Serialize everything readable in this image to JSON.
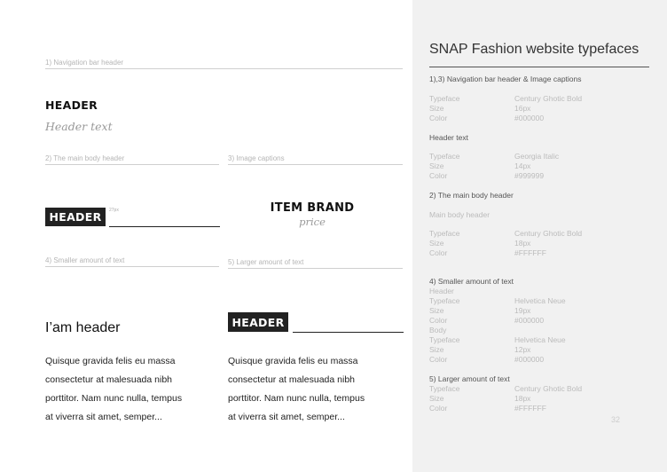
{
  "left": {
    "label1": "1) Navigation bar header",
    "header_demo": "HEADER",
    "header_text_demo": "Header text",
    "label2": "2) The main body header",
    "label3": "3) Image captions",
    "boxed_header": "HEADER",
    "tiny_label": "27px",
    "item_brand": "ITEM BRAND",
    "price": "price",
    "label4": "4) Smaller amount of text",
    "label5": "5) Larger amount of text",
    "iam_header": "I’am header",
    "boxed_header_2": "HEADER",
    "body_lines_left": [
      "Quisque gravida felis eu massa",
      "consectetur at malesuada nibh",
      "porttitor. Nam nunc nulla, tempus",
      "at viverra sit amet, semper..."
    ],
    "body_lines_right": [
      "Quisque gravida felis eu massa",
      "consectetur at malesuada nibh",
      "porttitor. Nam nunc nulla, tempus",
      "at viverra sit amet, semper..."
    ]
  },
  "right": {
    "title": "SNAP Fashion website typefaces",
    "s1_heading": "1),3) Navigation bar header &  Image captions",
    "s1": {
      "k1": "Typeface",
      "v1": "Century Ghotic Bold",
      "k2": "Size",
      "v2": "16px",
      "k3": "Color",
      "v3": "#000000"
    },
    "header_text_heading": "Header text",
    "s1b": {
      "k1": "Typeface",
      "v1": "Georgia Italic",
      "k2": "Size",
      "v2": "14px",
      "k3": "Color",
      "v3": "#999999"
    },
    "s2_heading": "2) The main body header",
    "s2_sub": "Main body header",
    "s2": {
      "k1": "Typeface",
      "v1": "Century Ghotic Bold",
      "k2": "Size",
      "v2": "18px",
      "k3": "Color",
      "v3": "#FFFFFF"
    },
    "s4_heading": "4)  Smaller amount of text",
    "s4_header": "Header",
    "s4a": {
      "k1": "Typeface",
      "v1": "Helvetica Neue",
      "k2": "Size",
      "v2": "19px",
      "k3": "Color",
      "v3": "#000000"
    },
    "s4_body": "Body",
    "s4b": {
      "k1": "Typeface",
      "v1": "Helvetica Neue",
      "k2": "Size",
      "v2": "12px",
      "k3": "Color",
      "v3": "#000000"
    },
    "s5_heading": "5) Larger amount of text",
    "s5": {
      "k1": "Typeface",
      "v1": "Century Ghotic Bold",
      "k2": "Size",
      "v2": "18px",
      "k3": "Color",
      "v3": "#FFFFFF"
    },
    "page_number": "32"
  },
  "colors": {
    "panel_bg": "#f1f1f1",
    "box_bg": "#222222",
    "muted": "#bbbbbb"
  }
}
